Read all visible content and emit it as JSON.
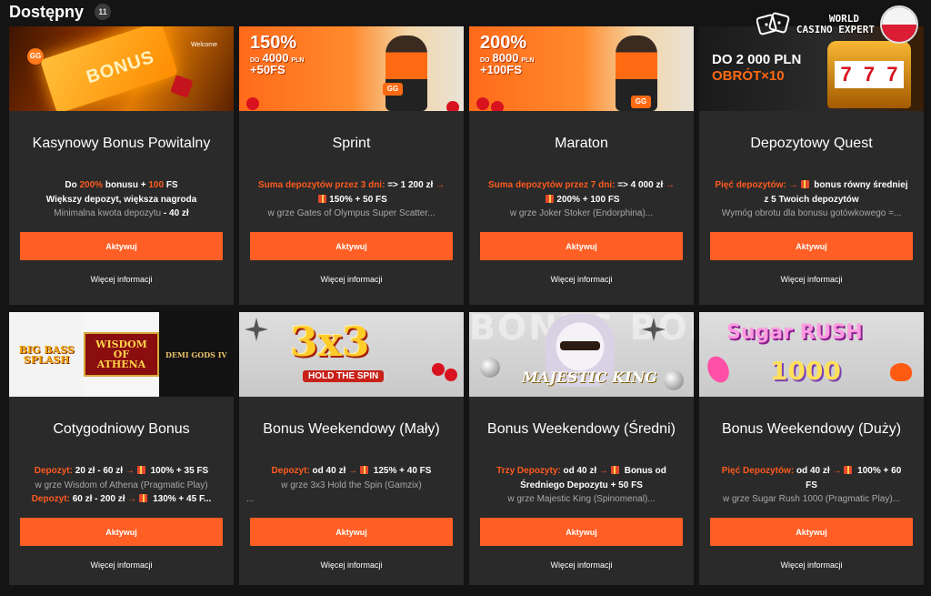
{
  "header": {
    "title": "Dostępny",
    "count": "11"
  },
  "watermark": {
    "line1": "WORLD",
    "line2": "CASINO EXPERT",
    "flag": "poland-flag-icon"
  },
  "colors": {
    "accent": "#ff5f24",
    "card_bg": "#2a2a2a",
    "page_bg": "#141414"
  },
  "cards": [
    {
      "title": "Kasynowy Bonus Powitalny",
      "banner": {
        "text": "BONUS",
        "tag": "Welcome"
      },
      "desc": {
        "l1a": "Do ",
        "l1b": "200%",
        "l1c": " bonusu + ",
        "l1d": "100",
        "l1e": " FS",
        "l2": "Większy depozyt, większa nagroda",
        "l3a": "Minimalna kwota depozytu",
        "l3b": " - 40 zł"
      },
      "button": "Aktywuj",
      "more": "Więcej informacji"
    },
    {
      "title": "Sprint",
      "banner": {
        "big": "150%",
        "small": "DO",
        "mid": "4000",
        "unit": "PLN",
        "fs": "+50FS",
        "badge": "GG"
      },
      "desc": {
        "l1a": "Suma depozytów przez 3 dni:",
        "l1b": " => 1 200 zł",
        "l2": "150% + 50 FS",
        "l3": "w grze Gates of Olympus Super Scatter..."
      },
      "button": "Aktywuj",
      "more": "Więcej informacji"
    },
    {
      "title": "Maraton",
      "banner": {
        "big": "200%",
        "small": "DO",
        "mid": "8000",
        "unit": "PLN",
        "fs": "+100FS",
        "badge": "GG"
      },
      "desc": {
        "l1a": "Suma depozytów przez 7 dni:",
        "l1b": " => 4 000 zł",
        "l2": "200% + 100 FS",
        "l3": "w grze Joker Stoker (Endorphina)..."
      },
      "button": "Aktywuj",
      "more": "Więcej informacji"
    },
    {
      "title": "Depozytowy Quest",
      "banner": {
        "l1": "DO 2 000 PLN",
        "l2": "OBRÓT×10",
        "reels": [
          "7",
          "7",
          "7"
        ]
      },
      "desc": {
        "l1a": "Pięć depozytów:",
        "l1b": " bonus równy średniej",
        "l2": "z 5 Twoich depozytów",
        "l3": "Wymóg obrotu dla bonusu gotówkowego =..."
      },
      "button": "Aktywuj",
      "more": "Więcej informacji"
    },
    {
      "title": "Cotygodniowy Bonus",
      "banner": {
        "logos": [
          "BIG BASS SPLASH",
          "WISDOM OF ATHENA",
          "DEMI GODS IV"
        ]
      },
      "desc": {
        "l1a": "Depozyt:",
        "l1b": " 20 zł - 60 zł",
        "l1c": " 100% + 35 FS",
        "l2": "w grze Wisdom of Athena (Pragmatic Play)",
        "l3a": "Depozyt:",
        "l3b": " 60 zł - 200 zł",
        "l3c": " 130% + 45 F..."
      },
      "button": "Aktywuj",
      "more": "Więcej informacji"
    },
    {
      "title": "Bonus Weekendowy (Mały)",
      "banner": {
        "logo": "3x3",
        "sub": "HOLD THE SPIN"
      },
      "desc": {
        "l1a": "Depozyt:",
        "l1b": " od 40 zł",
        "l1c": " 125% + 40 FS",
        "l2": "w grze 3x3 Hold the Spin (Gamzix)",
        "l3": "..."
      },
      "button": "Aktywuj",
      "more": "Więcej informacji"
    },
    {
      "title": "Bonus Weekendowy (Średni)",
      "banner": {
        "logo": "MAJESTIC KING",
        "bgtext": "BONUS BONUS"
      },
      "desc": {
        "l1a": "Trzy Depozyty:",
        "l1b": " od 40 zł",
        "l1c": " Bonus od",
        "l2": "Średniego Depozytu + 50 FS",
        "l3": "w grze Majestic King (Spinomenal)..."
      },
      "button": "Aktywuj",
      "more": "Więcej informacji"
    },
    {
      "title": "Bonus Weekendowy (Duży)",
      "banner": {
        "logo": "Sugar RUSH",
        "num": "1000"
      },
      "desc": {
        "l1a": "Pięć Depozytów:",
        "l1b": " od 40 zł",
        "l1c": " 100% + 60",
        "l2": "FS",
        "l3": "w grze Sugar Rush 1000 (Pragmatic Play)..."
      },
      "button": "Aktywuj",
      "more": "Więcej informacji"
    }
  ]
}
